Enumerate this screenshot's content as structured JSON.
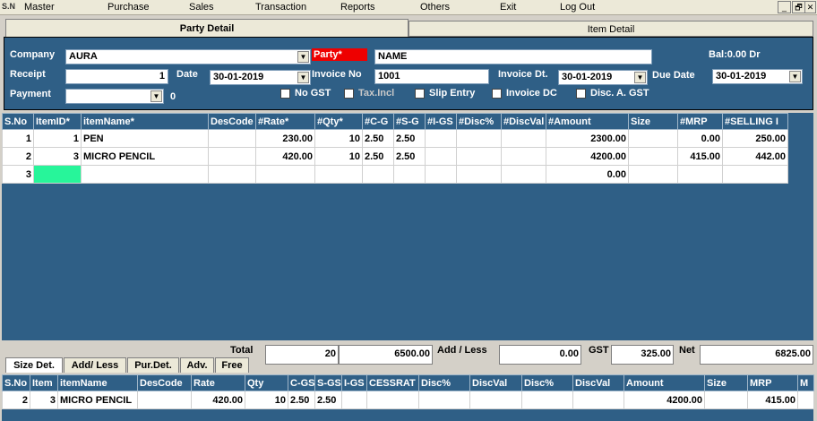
{
  "menu": {
    "icon_text": "S.N",
    "items": [
      "Master",
      "Purchase",
      "Sales",
      "Transaction",
      "Reports",
      "Others",
      "Exit",
      "Log Out"
    ]
  },
  "window_buttons": [
    "_",
    "🗗",
    "✕"
  ],
  "tabs": {
    "party": "Party Detail",
    "item": "Item Detail"
  },
  "form": {
    "company_label": "Company",
    "company_value": "AURA",
    "party_label": "Party*",
    "party_value": "NAME",
    "balance": "Bal:0.00 Dr",
    "receipt_label": "Receipt",
    "receipt_value": "1",
    "date_label": "Date",
    "date_value": "30-01-2019",
    "invoice_no_label": "Invoice No",
    "invoice_no_value": "1001",
    "invoice_dt_label": "Invoice Dt.",
    "invoice_dt_value": "30-01-2019",
    "due_date_label": "Due Date",
    "due_date_value": "30-01-2019",
    "payment_label": "Payment",
    "payment_value": "",
    "payment_zero": "0",
    "checks": [
      "No GST",
      "Tax.Incl",
      "Slip Entry",
      "Invoice DC",
      "Disc. A. GST"
    ]
  },
  "main_grid": {
    "columns": [
      "S.No",
      "ItemID*",
      "itemName*",
      "DesCode",
      "#Rate*",
      "#Qty*",
      "#C-G",
      "#S-G",
      "#I-GS",
      "#Disc%",
      "#DiscVal",
      "#Amount",
      "Size",
      "#MRP",
      "#SELLING I"
    ],
    "rows": [
      [
        "1",
        "1",
        "PEN",
        "",
        "230.00",
        "10",
        "2.50",
        "2.50",
        "",
        "",
        "",
        "2300.00",
        "",
        "0.00",
        "250.00"
      ],
      [
        "2",
        "3",
        "MICRO PENCIL",
        "",
        "420.00",
        "10",
        "2.50",
        "2.50",
        "",
        "",
        "",
        "4200.00",
        "",
        "415.00",
        "442.00"
      ],
      [
        "3",
        "",
        "",
        "",
        "",
        "",
        "",
        "",
        "",
        "",
        "",
        "0.00",
        "",
        "",
        ""
      ]
    ]
  },
  "totals": {
    "total_label": "Total",
    "qty": "20",
    "amount": "6500.00",
    "addless_label": "Add / Less",
    "addless": "0.00",
    "gst_label": "GST",
    "gst": "325.00",
    "net_label": "Net",
    "net": "6825.00"
  },
  "bottom_tabs": [
    "Size Det.",
    "Add/ Less",
    "Pur.Det.",
    "Adv.",
    "Free"
  ],
  "bottom_grid": {
    "columns": [
      "S.No",
      "Item",
      "itemName",
      "DesCode",
      "Rate",
      "Qty",
      "C-GS",
      "S-GS",
      "I-GS",
      "CESSRAT",
      "Disc%",
      "DiscVal",
      "Disc%",
      "DiscVal",
      "Amount",
      "Size",
      "MRP",
      "M"
    ],
    "rows": [
      [
        "2",
        "3",
        "MICRO PENCIL",
        "",
        "420.00",
        "10",
        "2.50",
        "2.50",
        "",
        "",
        "",
        "",
        "",
        "",
        "4200.00",
        "",
        "415.00",
        ""
      ]
    ]
  }
}
